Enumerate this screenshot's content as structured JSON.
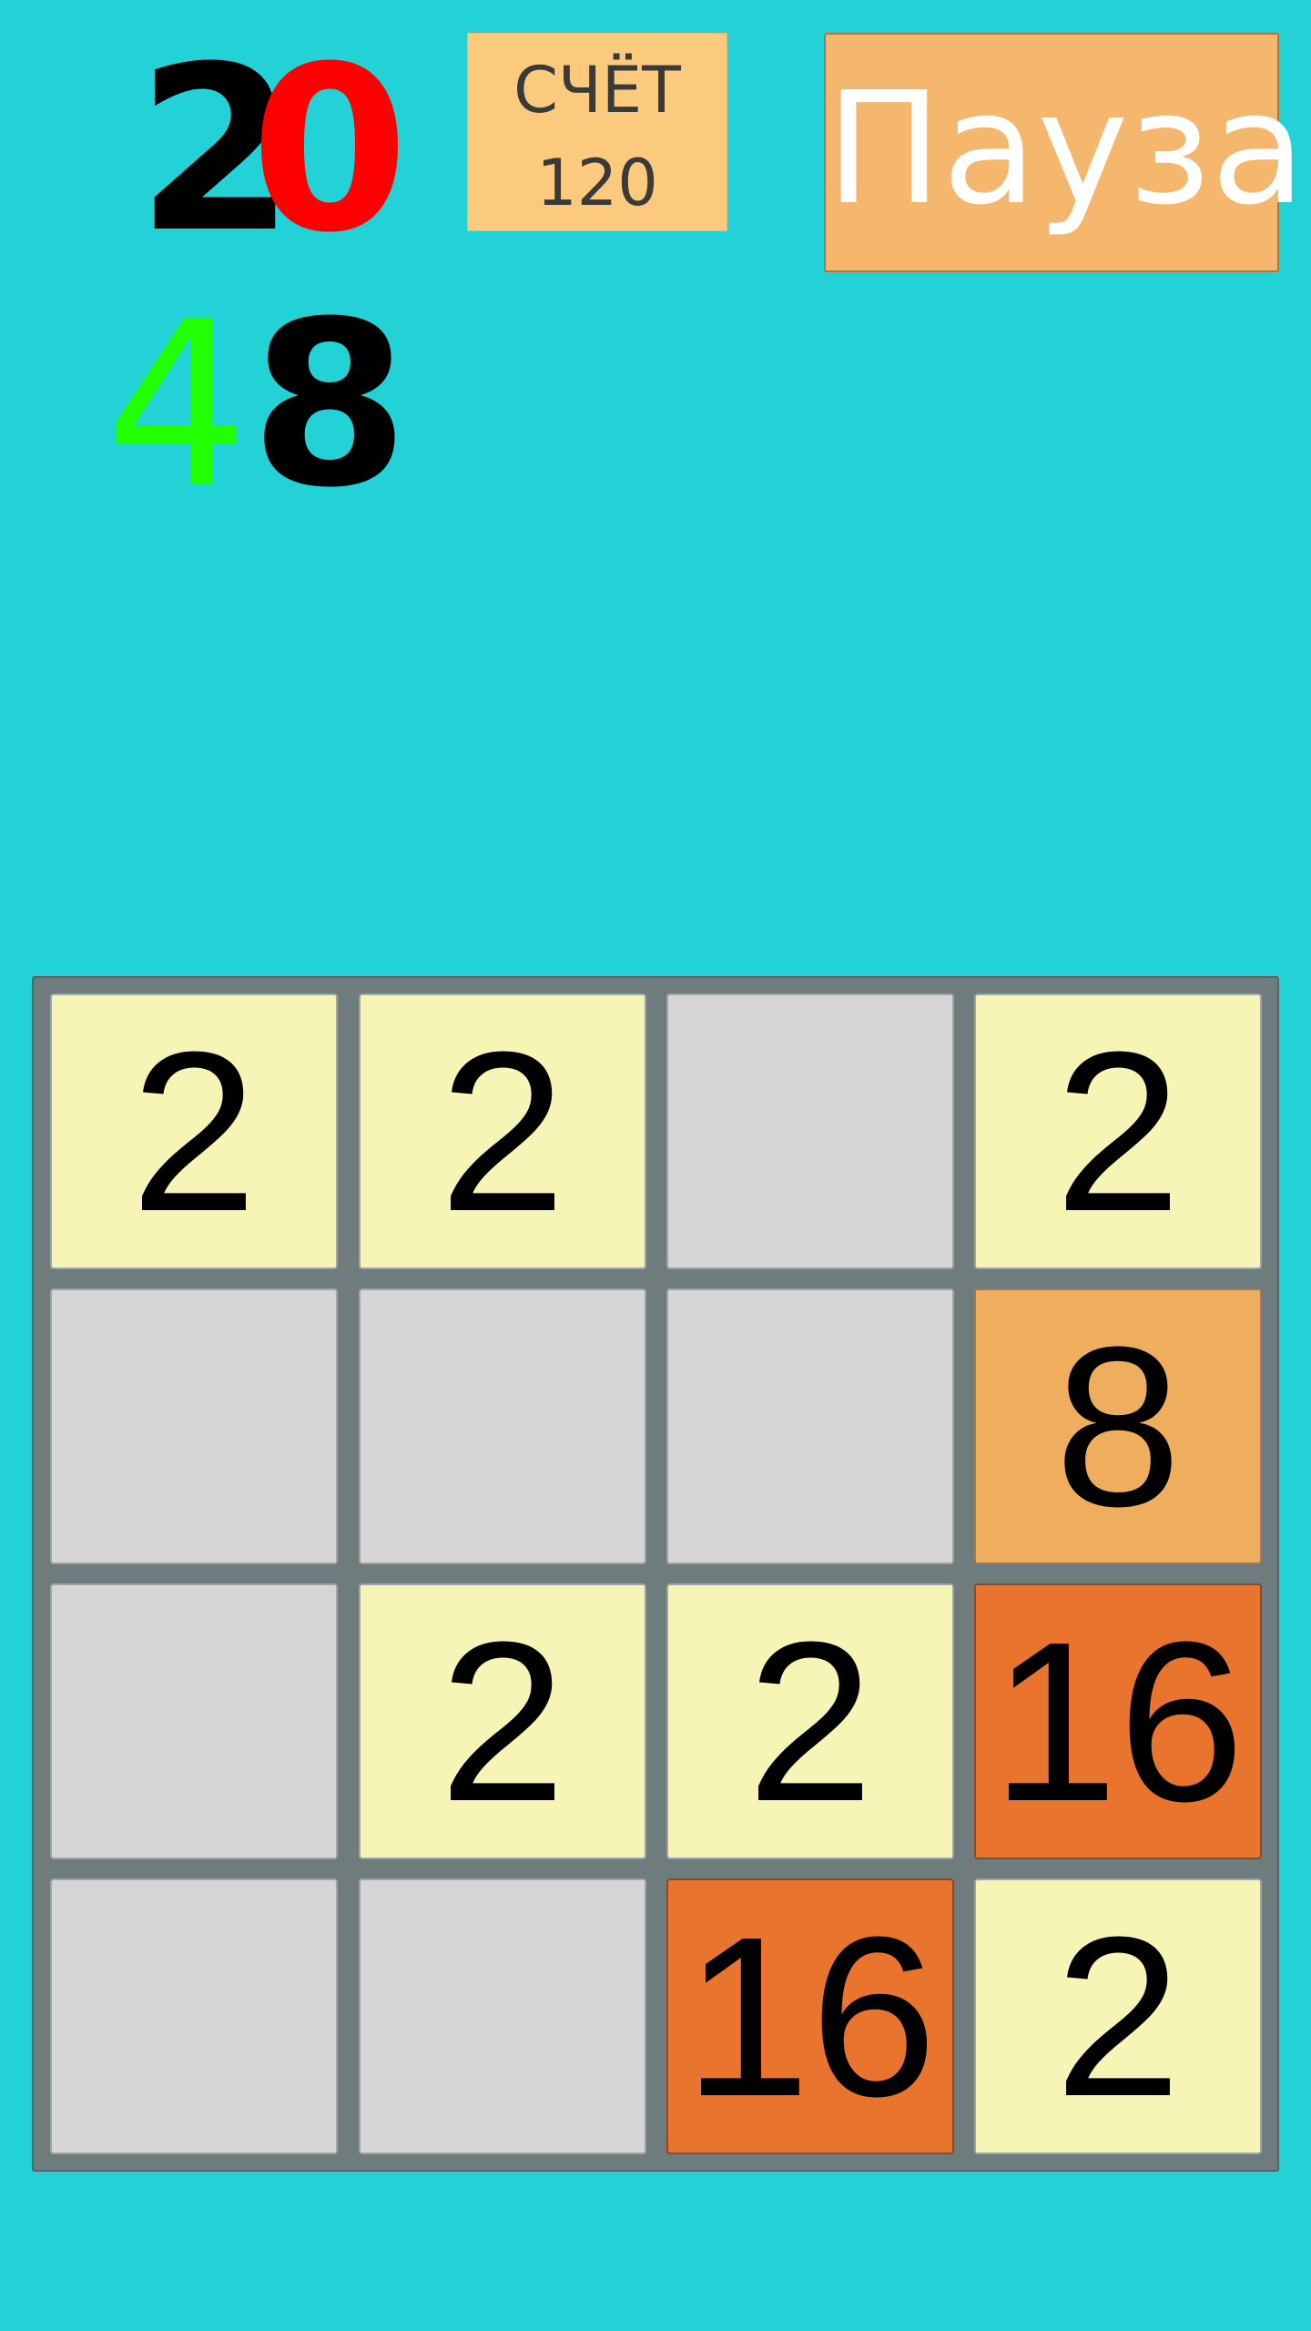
{
  "logo": {
    "digits": [
      {
        "char": "2",
        "color": "#000000"
      },
      {
        "char": "0",
        "color": "#ff0000"
      },
      {
        "char": "4",
        "color": "#22ff00"
      },
      {
        "char": "8",
        "color": "#000000"
      }
    ]
  },
  "score": {
    "label": "СЧЁТ",
    "value": "120"
  },
  "pause": {
    "label": "Пауза"
  },
  "board": {
    "size": 4,
    "colors": {
      "empty": "#d6d6d6",
      "2": "#f6f5b6",
      "8": "#efad5e",
      "16": "#e8742e"
    },
    "tiles": [
      [
        "2",
        "2",
        "",
        "2"
      ],
      [
        "",
        "",
        "",
        "8"
      ],
      [
        "",
        "2",
        "2",
        "16"
      ],
      [
        "",
        "",
        "16",
        "2"
      ]
    ]
  }
}
